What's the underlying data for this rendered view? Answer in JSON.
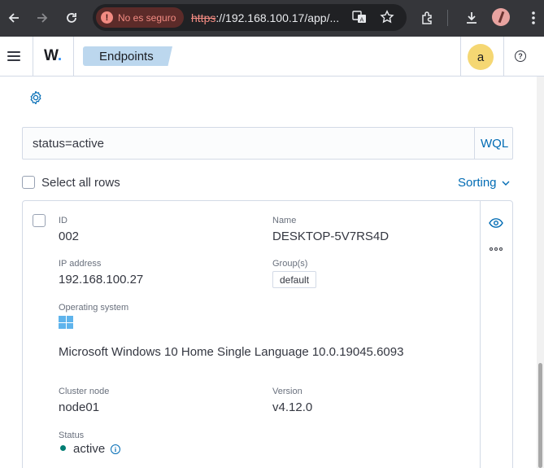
{
  "browser": {
    "security_chip": "No es seguro",
    "url_scheme": "https",
    "url_rest": "://192.168.100.17/app/...",
    "icons": [
      "back-arrow-icon",
      "forward-arrow-icon",
      "reload-icon",
      "translate-icon",
      "star-icon",
      "extensions-icon",
      "download-icon",
      "profile-avatar",
      "kebab-menu-icon"
    ]
  },
  "header": {
    "logo_text": "W",
    "logo_dot": ".",
    "breadcrumb": "Endpoints",
    "user_initial": "a",
    "help_glyph": "?",
    "accent_color": "#006bb4",
    "logo_dot_color": "#3595f9"
  },
  "search": {
    "query": "status=active",
    "wql_label": "WQL"
  },
  "table": {
    "select_all_label": "Select all rows",
    "sorting_label": "Sorting"
  },
  "agent": {
    "id_label": "ID",
    "id": "002",
    "name_label": "Name",
    "name": "DESKTOP-5V7RS4D",
    "ip_label": "IP address",
    "ip": "192.168.100.27",
    "groups_label": "Group(s)",
    "group": "default",
    "os_label": "Operating system",
    "os_icon": "windows-icon",
    "os": "Microsoft Windows 10 Home Single Language 10.0.19045.6093",
    "cluster_label": "Cluster node",
    "cluster": "node01",
    "version_label": "Version",
    "version": "v4.12.0",
    "status_label": "Status",
    "status": "active",
    "status_color": "#017d73",
    "info_glyph": "i"
  }
}
